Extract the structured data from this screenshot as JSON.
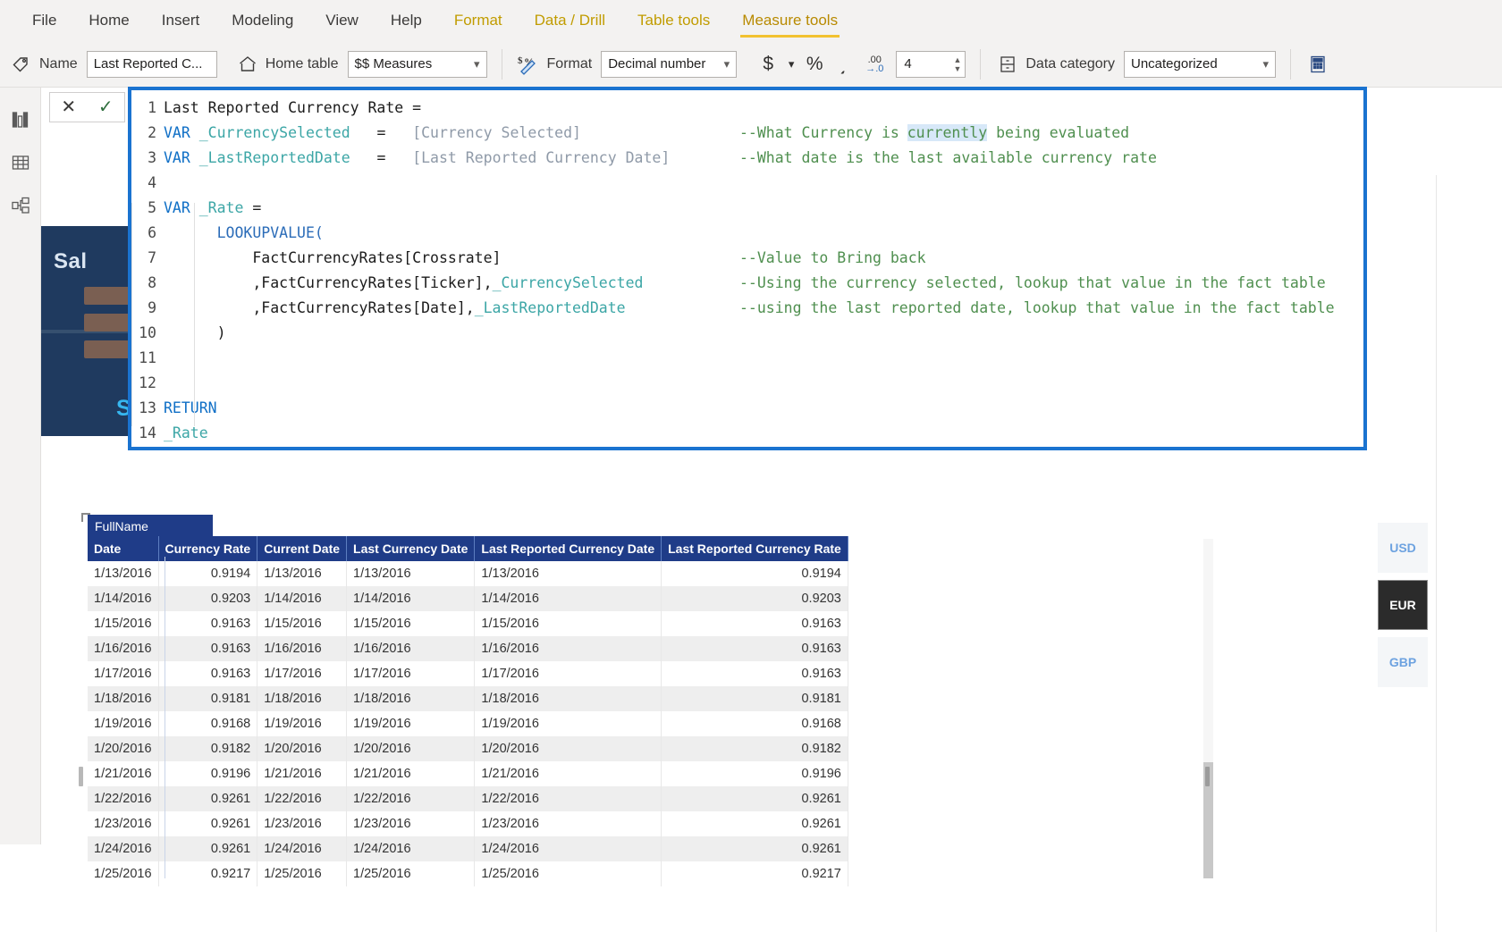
{
  "ribbon": {
    "tabs": [
      {
        "label": "File",
        "kind": "normal"
      },
      {
        "label": "Home",
        "kind": "normal"
      },
      {
        "label": "Insert",
        "kind": "normal"
      },
      {
        "label": "Modeling",
        "kind": "normal"
      },
      {
        "label": "View",
        "kind": "normal"
      },
      {
        "label": "Help",
        "kind": "normal"
      },
      {
        "label": "Format",
        "kind": "context"
      },
      {
        "label": "Data / Drill",
        "kind": "context"
      },
      {
        "label": "Table tools",
        "kind": "context"
      },
      {
        "label": "Measure tools",
        "kind": "context-active"
      }
    ],
    "name_label": "Name",
    "name_value": "Last Reported C...",
    "home_table_label": "Home table",
    "home_table_value": "$$ Measures",
    "format_label": "Format",
    "format_value": "Decimal number",
    "currency_symbol": "$",
    "percent_symbol": "%",
    "thousands_symbol": "͵",
    "decimals_value": "4",
    "decimals_icon_top": ".00",
    "decimals_icon_bottom": "→.0",
    "data_category_label": "Data category",
    "data_category_value": "Uncategorized"
  },
  "navrail": {
    "items": [
      {
        "name": "report-view",
        "label": "Report view"
      },
      {
        "name": "data-view",
        "label": "Data view"
      },
      {
        "name": "model-view",
        "label": "Model view"
      }
    ]
  },
  "editor": {
    "cancel_glyph": "✕",
    "commit_glyph": "✓",
    "lines": [
      {
        "n": "1",
        "segs": [
          {
            "t": "Last Reported Currency Rate =",
            "c": "plain"
          }
        ],
        "comment": ""
      },
      {
        "n": "2",
        "segs": [
          {
            "t": "VAR ",
            "c": "kw"
          },
          {
            "t": "_CurrencySelected",
            "c": "var"
          },
          {
            "t": "   =   ",
            "c": "op"
          },
          {
            "t": "[Currency Selected]",
            "c": "ref"
          }
        ],
        "comment": "--What Currency is currently being evaluated"
      },
      {
        "n": "3",
        "segs": [
          {
            "t": "VAR ",
            "c": "kw"
          },
          {
            "t": "_LastReportedDate",
            "c": "var"
          },
          {
            "t": "   =   ",
            "c": "op"
          },
          {
            "t": "[Last Reported Currency Date]",
            "c": "ref"
          }
        ],
        "comment": "--What date is the last available currency rate"
      },
      {
        "n": "4",
        "segs": [],
        "comment": ""
      },
      {
        "n": "5",
        "segs": [
          {
            "t": "VAR ",
            "c": "kw"
          },
          {
            "t": "_Rate",
            "c": "var"
          },
          {
            "t": " =",
            "c": "op"
          }
        ],
        "comment": ""
      },
      {
        "n": "6",
        "segs": [
          {
            "t": "      ",
            "c": "plain"
          },
          {
            "t": "LOOKUPVALUE(",
            "c": "fn"
          }
        ],
        "comment": ""
      },
      {
        "n": "7",
        "segs": [
          {
            "t": "          FactCurrencyRates[Crossrate]",
            "c": "plain"
          }
        ],
        "comment": "--Value to Bring back"
      },
      {
        "n": "8",
        "segs": [
          {
            "t": "          ,FactCurrencyRates[Ticker],",
            "c": "plain"
          },
          {
            "t": "_CurrencySelected",
            "c": "var"
          }
        ],
        "comment": "--Using the currency selected, lookup that value in the fact table"
      },
      {
        "n": "9",
        "segs": [
          {
            "t": "          ,FactCurrencyRates[Date],",
            "c": "plain"
          },
          {
            "t": "_LastReportedDate",
            "c": "var"
          }
        ],
        "comment": "--using the last reported date, lookup that value in the fact table"
      },
      {
        "n": "10",
        "segs": [
          {
            "t": "      )",
            "c": "plain"
          }
        ],
        "comment": ""
      },
      {
        "n": "11",
        "segs": [],
        "comment": ""
      },
      {
        "n": "12",
        "segs": [],
        "comment": ""
      },
      {
        "n": "13",
        "segs": [
          {
            "t": "RETURN",
            "c": "kw"
          }
        ],
        "comment": ""
      },
      {
        "n": "14",
        "segs": [
          {
            "t": "_Rate",
            "c": "var"
          }
        ],
        "comment": ""
      }
    ],
    "selected_word": "currently"
  },
  "report": {
    "image_card": {
      "title_top": "Sal",
      "title_bottom": "Sup"
    },
    "table": {
      "group_header": "FullName",
      "columns": [
        {
          "label": "Date",
          "align": "left"
        },
        {
          "label": "Currency Rate",
          "align": "right"
        },
        {
          "label": "Current Date",
          "align": "left"
        },
        {
          "label": "Last Currency Date",
          "align": "left"
        },
        {
          "label": "Last Reported Currency Date",
          "align": "left"
        },
        {
          "label": "Last Reported Currency Rate",
          "align": "right"
        }
      ],
      "rows": [
        [
          "1/13/2016",
          "0.9194",
          "1/13/2016",
          "1/13/2016",
          "1/13/2016",
          "0.9194"
        ],
        [
          "1/14/2016",
          "0.9203",
          "1/14/2016",
          "1/14/2016",
          "1/14/2016",
          "0.9203"
        ],
        [
          "1/15/2016",
          "0.9163",
          "1/15/2016",
          "1/15/2016",
          "1/15/2016",
          "0.9163"
        ],
        [
          "1/16/2016",
          "0.9163",
          "1/16/2016",
          "1/16/2016",
          "1/16/2016",
          "0.9163"
        ],
        [
          "1/17/2016",
          "0.9163",
          "1/17/2016",
          "1/17/2016",
          "1/17/2016",
          "0.9163"
        ],
        [
          "1/18/2016",
          "0.9181",
          "1/18/2016",
          "1/18/2016",
          "1/18/2016",
          "0.9181"
        ],
        [
          "1/19/2016",
          "0.9168",
          "1/19/2016",
          "1/19/2016",
          "1/19/2016",
          "0.9168"
        ],
        [
          "1/20/2016",
          "0.9182",
          "1/20/2016",
          "1/20/2016",
          "1/20/2016",
          "0.9182"
        ],
        [
          "1/21/2016",
          "0.9196",
          "1/21/2016",
          "1/21/2016",
          "1/21/2016",
          "0.9196"
        ],
        [
          "1/22/2016",
          "0.9261",
          "1/22/2016",
          "1/22/2016",
          "1/22/2016",
          "0.9261"
        ],
        [
          "1/23/2016",
          "0.9261",
          "1/23/2016",
          "1/23/2016",
          "1/23/2016",
          "0.9261"
        ],
        [
          "1/24/2016",
          "0.9261",
          "1/24/2016",
          "1/24/2016",
          "1/24/2016",
          "0.9261"
        ],
        [
          "1/25/2016",
          "0.9217",
          "1/25/2016",
          "1/25/2016",
          "1/25/2016",
          "0.9217"
        ]
      ]
    },
    "currency_slicer": {
      "items": [
        {
          "label": "USD",
          "selected": false
        },
        {
          "label": "EUR",
          "selected": true
        },
        {
          "label": "GBP",
          "selected": false
        }
      ]
    }
  },
  "colors": {
    "accent_blue": "#1a73d0",
    "table_header": "#1f3c88",
    "ribbon_bg": "#f3f2f1",
    "context_tab": "#c19c00",
    "slicer_selected": "#2b2b2b"
  }
}
